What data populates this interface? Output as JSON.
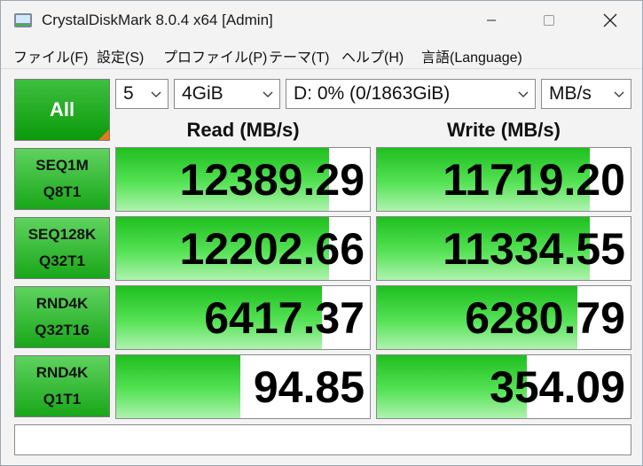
{
  "window": {
    "title": "CrystalDiskMark 8.0.4 x64 [Admin]"
  },
  "menu": [
    "ファイル(F)",
    "設定(S)",
    "プロファイル(P)",
    "テーマ(T)",
    "ヘルプ(H)",
    "言語(Language)"
  ],
  "controls": {
    "all_label": "All",
    "count": "5",
    "size": "4GiB",
    "drive": "D: 0% (0/1863GiB)",
    "unit": "MB/s"
  },
  "columns": {
    "read": "Read (MB/s)",
    "write": "Write (MB/s)"
  },
  "tests": [
    {
      "line1": "SEQ1M",
      "line2": "Q8T1",
      "read": "12389.29",
      "write": "11719.20",
      "read_level": 0.84,
      "write_level": 0.84
    },
    {
      "line1": "SEQ128K",
      "line2": "Q32T1",
      "read": "12202.66",
      "write": "11334.55",
      "read_level": 0.84,
      "write_level": 0.84
    },
    {
      "line1": "RND4K",
      "line2": "Q32T16",
      "read": "6417.37",
      "write": "6280.79",
      "read_level": 0.81,
      "write_level": 0.79
    },
    {
      "line1": "RND4K",
      "line2": "Q1T1",
      "read": "94.85",
      "write": "354.09",
      "read_level": 0.49,
      "write_level": 0.59
    }
  ],
  "comment": "",
  "colors": {
    "accent_green": "#1fbf1f",
    "corner_orange": "#e8761c"
  },
  "icons": {
    "app": "crystaldiskmark-icon",
    "minimize": "minimize-icon",
    "maximize": "maximize-icon",
    "close": "close-icon"
  }
}
